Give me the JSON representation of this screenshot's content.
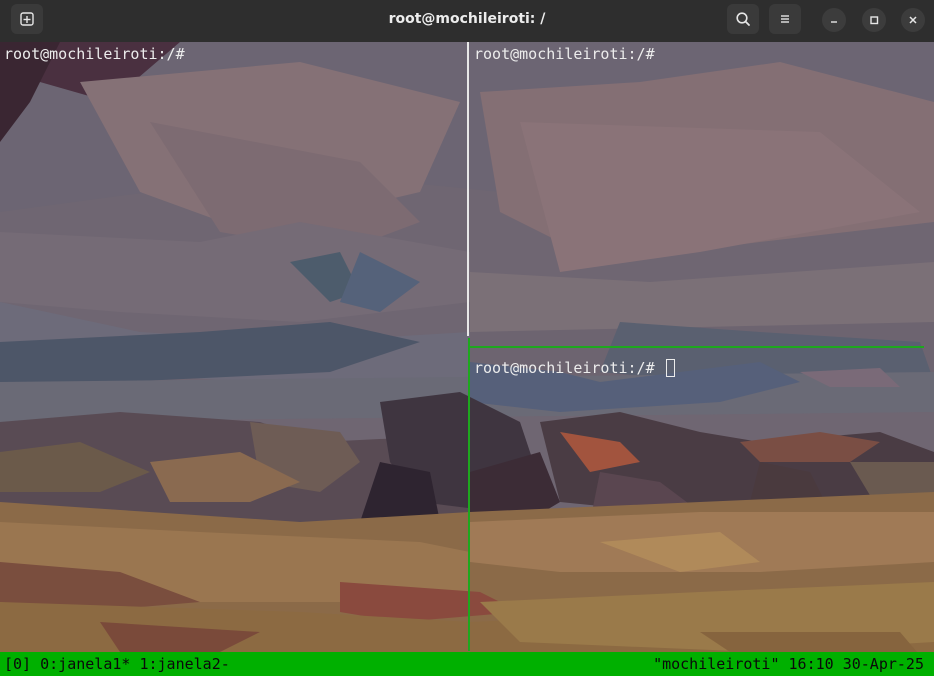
{
  "window": {
    "title": "root@mochileiroti: /"
  },
  "icons": {
    "new_tab": "new-tab-icon",
    "search": "search-icon",
    "menu": "hamburger-menu-icon",
    "minimize": "minimize-icon",
    "maximize": "maximize-icon",
    "close": "close-icon"
  },
  "panes": {
    "left": {
      "prompt": "root@mochileiroti:/#"
    },
    "right_top": {
      "prompt": "root@mochileiroti:/#"
    },
    "right_bottom": {
      "prompt": "root@mochileiroti:/# "
    }
  },
  "tmux": {
    "session": "[0]",
    "windows": "0:janela1* 1:janela2-",
    "host": "\"mochileiroti\"",
    "time": "16:10",
    "date": "30-Apr-25"
  },
  "colors": {
    "status_bar": "#00b000",
    "active_pane_border": "#1ea81e",
    "inactive_pane_border": "#e8e8e8"
  }
}
